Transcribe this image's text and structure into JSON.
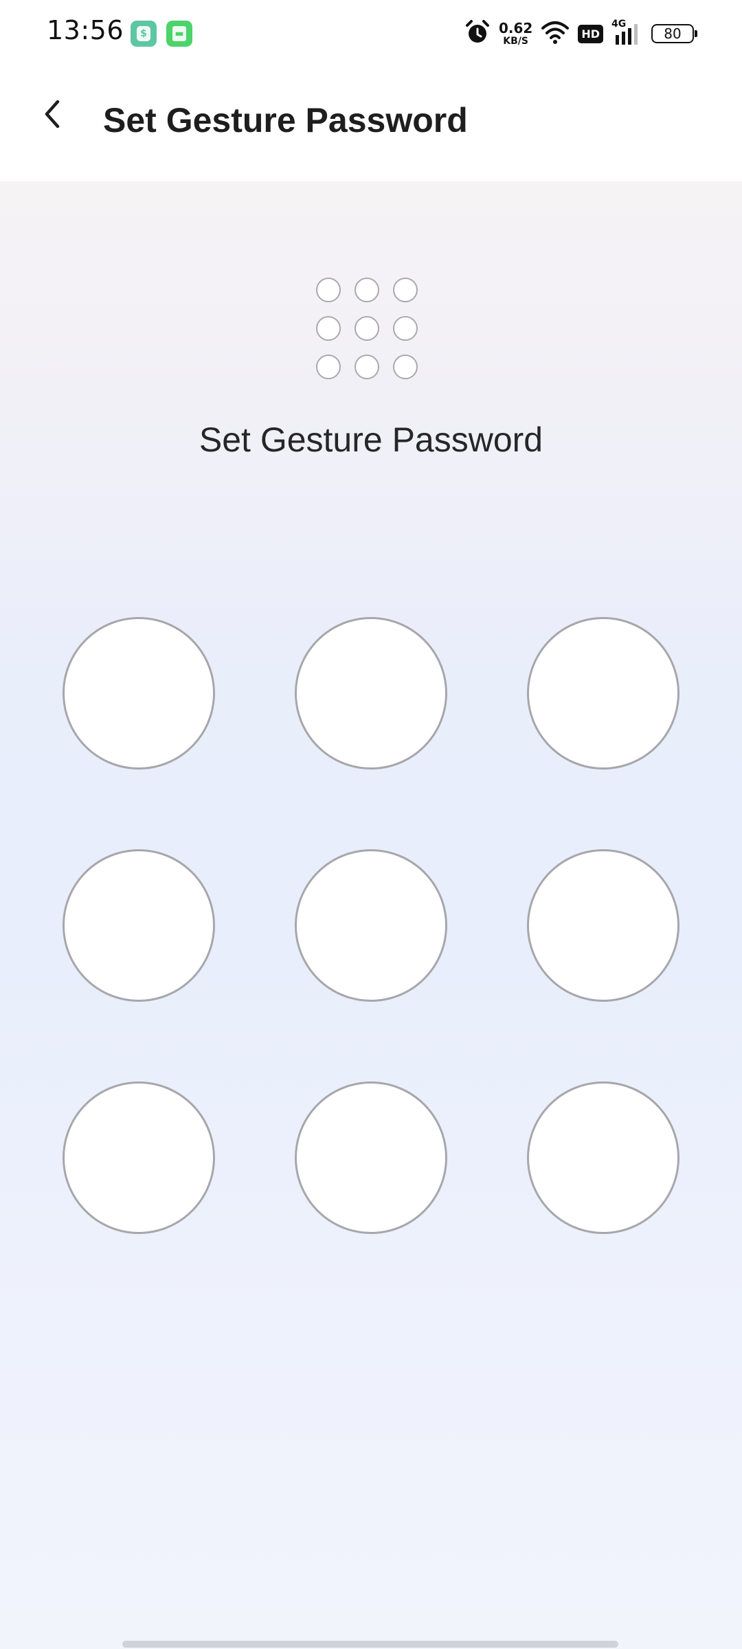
{
  "status_bar": {
    "time": "13:56",
    "app_icons": [
      "shield-app-icon",
      "message-app-icon"
    ],
    "net_speed_value": "0.62",
    "net_speed_unit": "KB/S",
    "hd_label": "HD",
    "network_type": "4G",
    "battery": "80"
  },
  "header": {
    "title": "Set Gesture Password",
    "back_icon": "chevron-left-icon"
  },
  "main": {
    "prompt": "Set Gesture Password",
    "preview_dot_count": 9,
    "pattern_node_count": 9
  }
}
